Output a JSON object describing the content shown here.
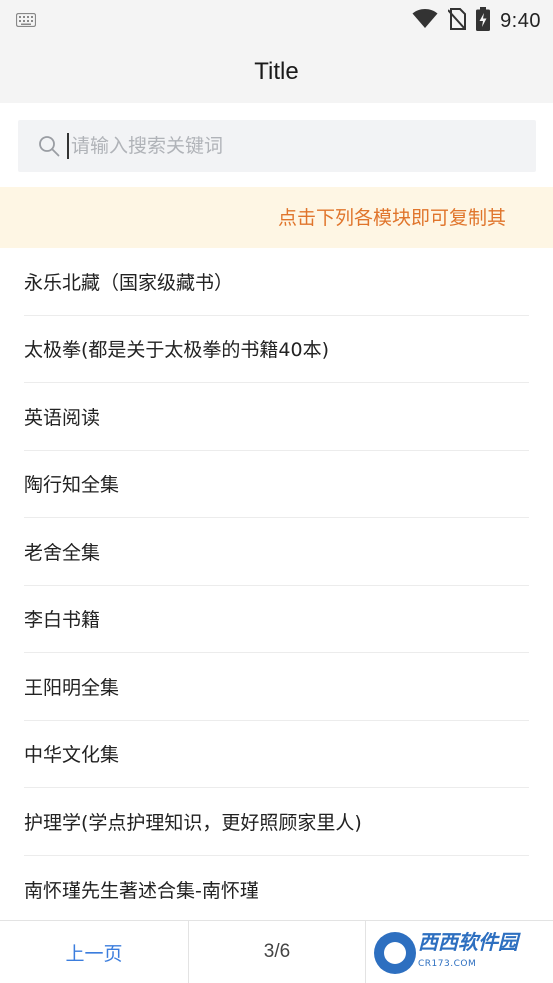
{
  "status_bar": {
    "time": "9:40",
    "icons": [
      "keyboard-icon",
      "wifi-icon",
      "no-sim-icon",
      "battery-charging-icon"
    ]
  },
  "header": {
    "title": "Title"
  },
  "search": {
    "placeholder": "请输入搜索关键词",
    "value": ""
  },
  "notice": {
    "text": "点击下列各模块即可复制其"
  },
  "list": {
    "items": [
      "永乐北藏（国家级藏书）",
      "太极拳(都是关于太极拳的书籍40本)",
      "英语阅读",
      "陶行知全集",
      "老舍全集",
      "李白书籍",
      "王阳明全集",
      "中华文化集",
      "护理学(学点护理知识，更好照顾家里人)",
      "南怀瑾先生著述合集-南怀瑾"
    ]
  },
  "pager": {
    "prev_label": "上一页",
    "page_indicator": "3/6"
  },
  "watermark": {
    "brand": "西西软件园",
    "sub": "CR173.COM"
  },
  "colors": {
    "accent": "#3b7ddd",
    "notice_bg": "#fef6e4",
    "notice_text": "#e0752c"
  }
}
